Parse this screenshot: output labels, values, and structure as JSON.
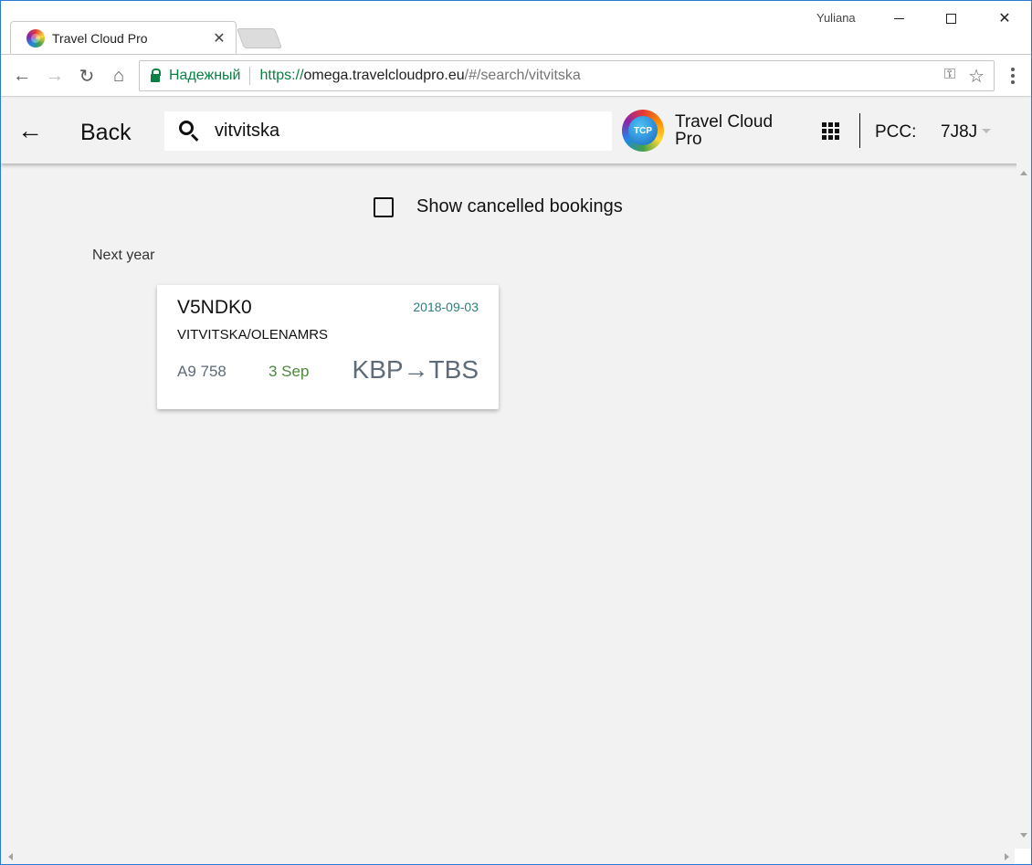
{
  "browser": {
    "tab_title": "Travel Cloud Pro",
    "tab_close": "✕",
    "window_user": "Yuliana",
    "window_controls": {
      "minimize": "minimize-icon",
      "maximize": "maximize-icon",
      "close": "✕"
    },
    "nav": {
      "back": "←",
      "forward": "→",
      "reload": "↻",
      "home": "⌂"
    },
    "address": {
      "security_label": "Надежный",
      "url_scheme": "https://",
      "url_host": "omega.travelcloudpro.eu",
      "url_path": "/#/search/vitvitska"
    },
    "key_icon": "⚿",
    "star_icon": "☆"
  },
  "app": {
    "back_arrow": "←",
    "back_label": "Back",
    "search": {
      "value": "vitvitska",
      "placeholder": ""
    },
    "logo_text": "TCP",
    "brand_name": "Travel Cloud Pro",
    "pcc_label": "PCC:",
    "pcc_value": "7J8J"
  },
  "content": {
    "show_cancelled_label": "Show cancelled bookings",
    "show_cancelled_checked": false,
    "section_label": "Next year",
    "bookings": [
      {
        "code": "V5NDK0",
        "date": "2018-09-03",
        "passenger": "VITVITSKA/OLENAMRS",
        "flight": "A9 758",
        "day": "3 Sep",
        "route": "KBP→TBS"
      }
    ]
  },
  "colors": {
    "window_border": "#2b79d0",
    "secure_green": "#0b8043",
    "date_teal": "#2e7d7a",
    "day_green": "#4a8a3a",
    "route_slate": "#5e6b78",
    "background": "#f2f2f2"
  }
}
